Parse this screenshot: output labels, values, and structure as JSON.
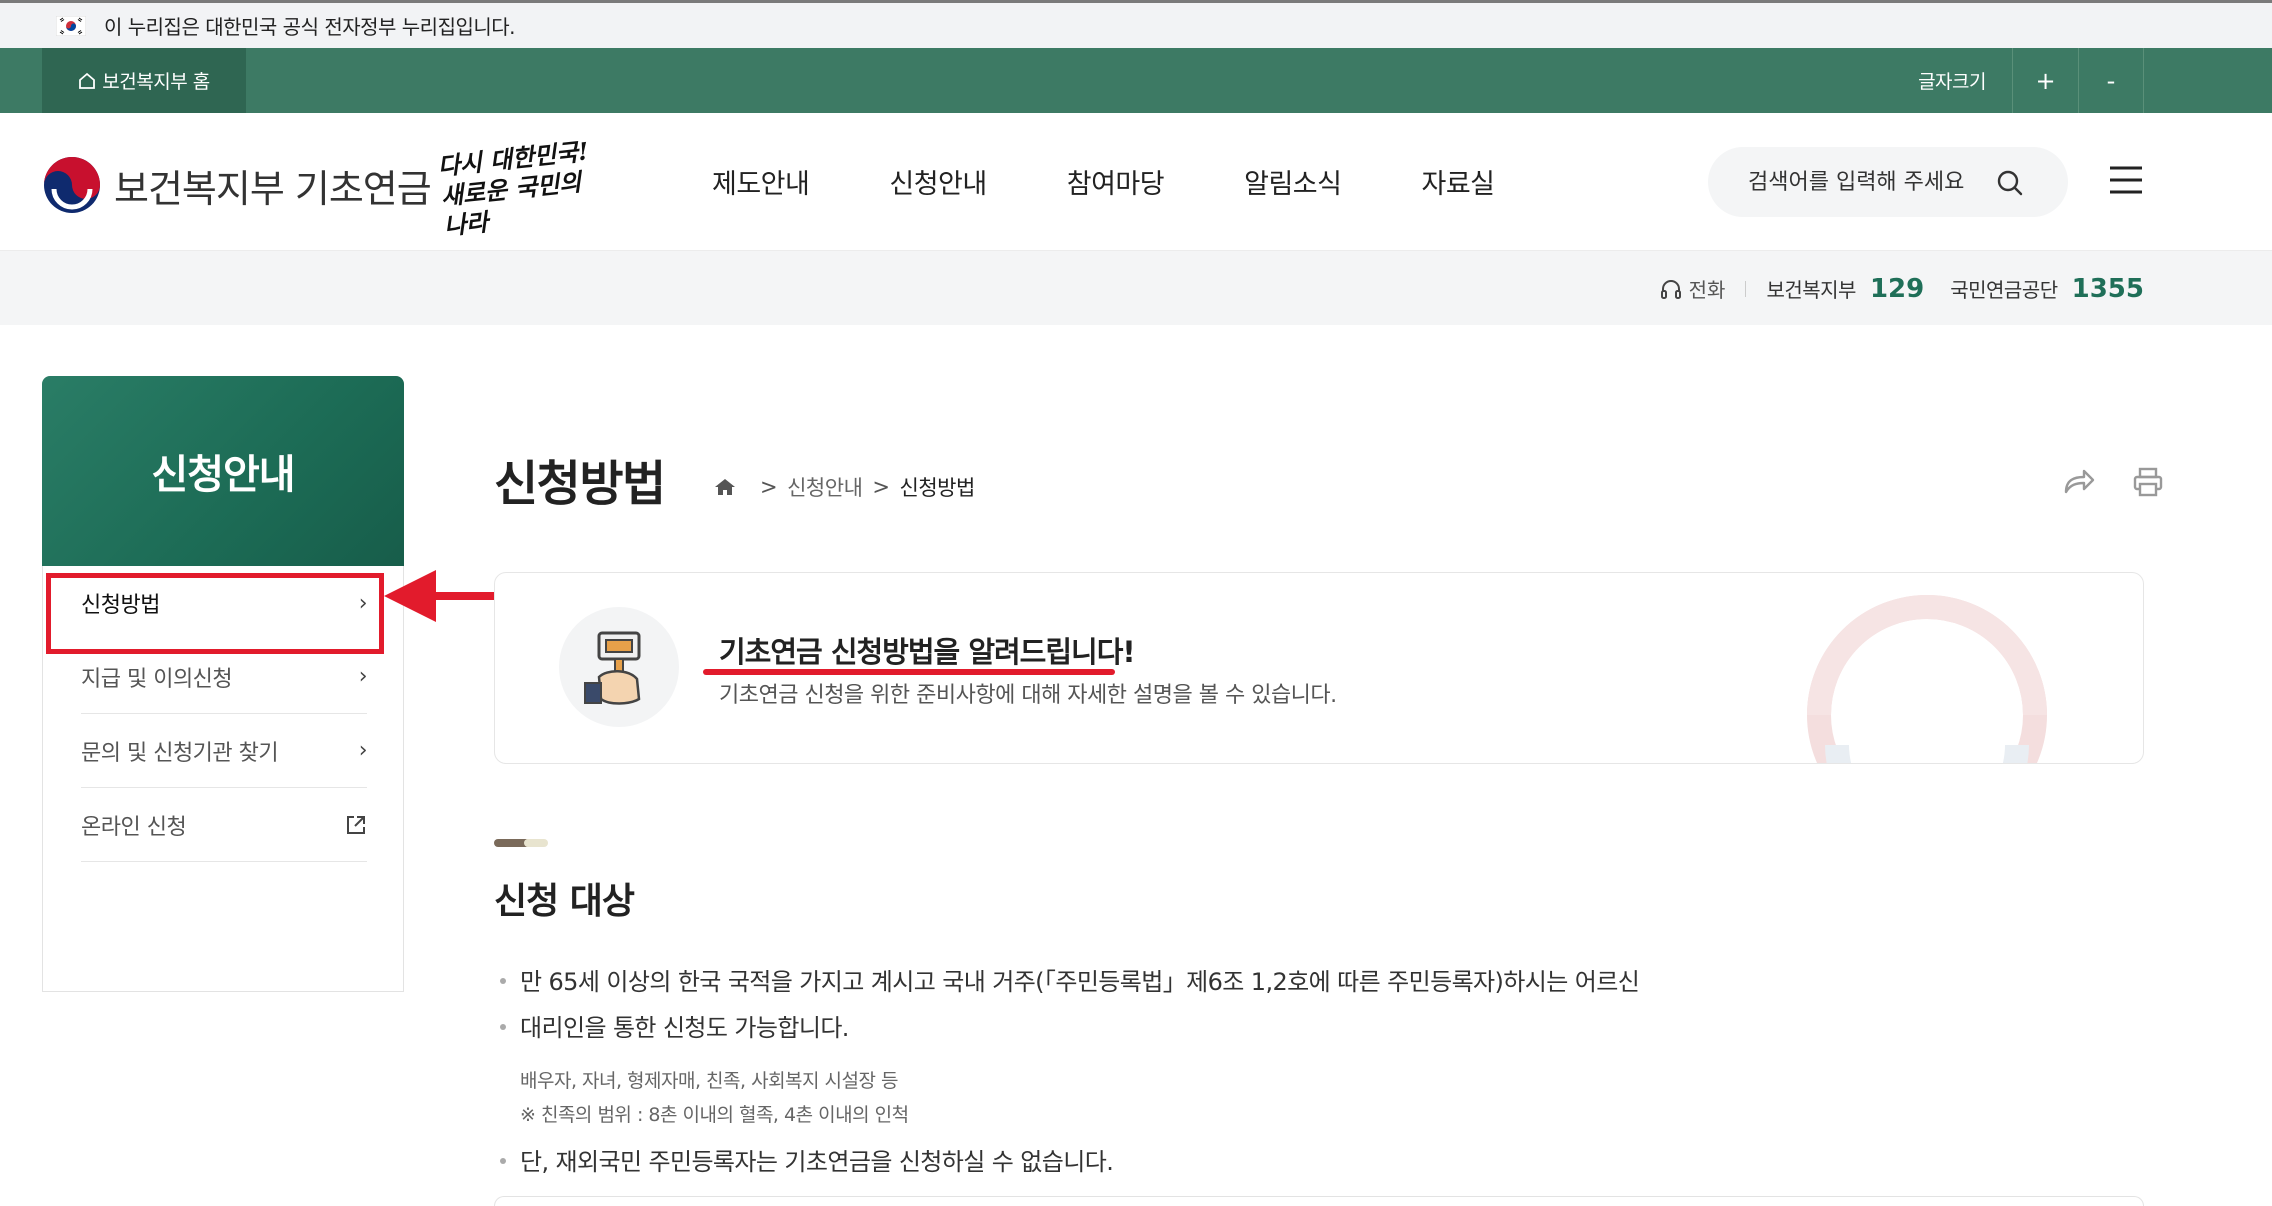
{
  "gov_banner": {
    "text": "이 누리집은 대한민국 공식 전자정부 누리집입니다."
  },
  "util_bar": {
    "home_label": "보건복지부 홈",
    "font_size_label": "글자크기",
    "increase": "+",
    "decrease": "-"
  },
  "header": {
    "site_name": "보건복지부 기초연금",
    "slogan_line1": "다시 대한민국!",
    "slogan_line2": "새로운 국민의 나라",
    "nav": [
      "제도안내",
      "신청안내",
      "참여마당",
      "알림소식",
      "자료실"
    ],
    "search_placeholder": "검색어를 입력해 주세요"
  },
  "contact": {
    "phone_label": "전화",
    "org1": "보건복지부",
    "num1": "129",
    "org2": "국민연금공단",
    "num2": "1355"
  },
  "sidebar": {
    "title": "신청안내",
    "items": [
      {
        "label": "신청방법",
        "icon": "chevron-right-icon"
      },
      {
        "label": "지급 및 이의신청",
        "icon": "chevron-right-icon"
      },
      {
        "label": "문의 및 신청기관 찾기",
        "icon": "chevron-right-icon"
      },
      {
        "label": "온라인 신청",
        "icon": "external-link-icon"
      }
    ]
  },
  "main": {
    "page_title": "신청방법",
    "breadcrumb": [
      "신청안내",
      "신청방법"
    ],
    "intro_headline": "기초연금 신청방법을 알려드립니다!",
    "intro_desc": "기초연금 신청을 위한 준비사항에 대해 자세한 설명을 볼 수 있습니다.",
    "section_title": "신청 대상",
    "bullets": [
      "만 65세 이상의 한국 국적을 가지고 계시고 국내 거주(「주민등록법」제6조 1,2호에 따른 주민등록자)하시는 어르신",
      "대리인을 통한 신청도 가능합니다.",
      "단, 재외국민 주민등록자는 기초연금을 신청하실 수 없습니다."
    ],
    "sub_notes": [
      "배우자, 자녀, 형제자매, 친족, 사회복지 시설장 등",
      "※ 친족의 범위 : 8촌 이내의 혈족, 4촌 이내의 인척"
    ]
  },
  "colors": {
    "brand_green": "#3d7a64",
    "side_head_green": "#1c6b55",
    "accent_number": "#1f6f58",
    "annotation_red": "#e21b2c"
  }
}
